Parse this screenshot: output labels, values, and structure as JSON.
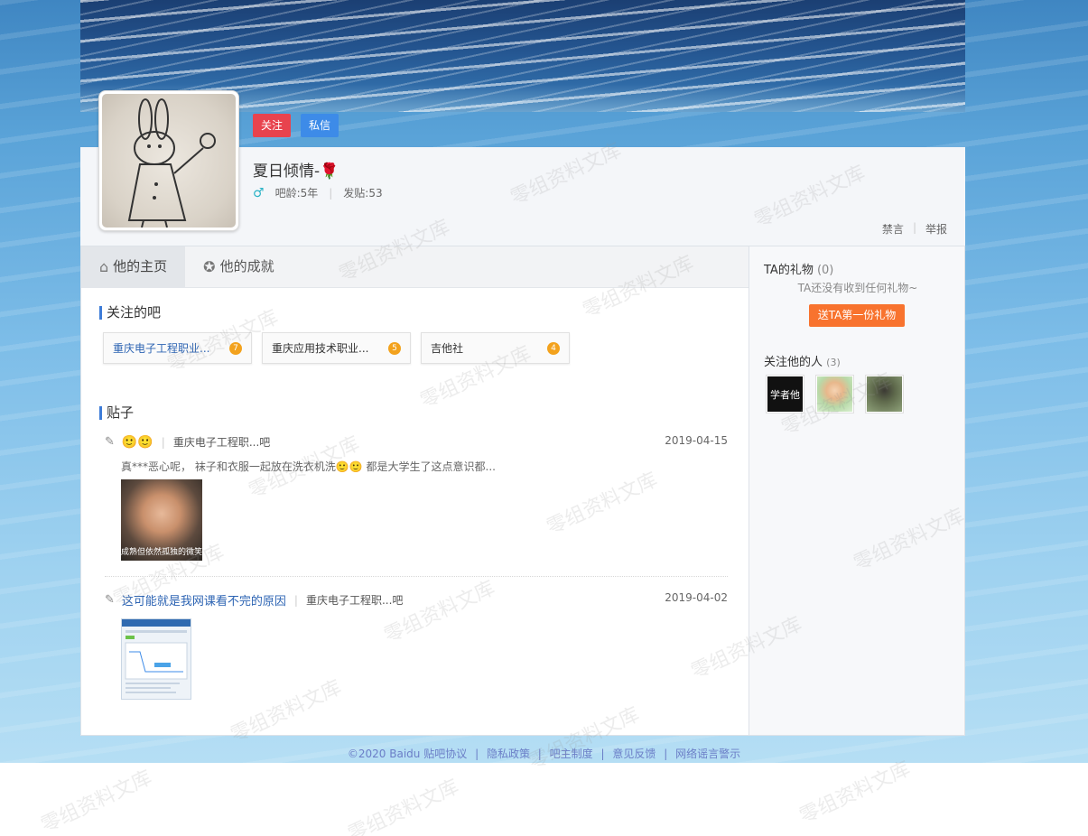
{
  "header": {
    "follow_label": "关注",
    "message_label": "私信",
    "username": "夏日倾情-🌹",
    "age_label": "吧龄:5年",
    "posts_label": "发贴:53",
    "mute_label": "禁言",
    "report_label": "举报"
  },
  "tabs": [
    {
      "label": "他的主页",
      "icon": "home-icon",
      "active": true
    },
    {
      "label": "他的成就",
      "icon": "badge-icon",
      "active": false
    }
  ],
  "followed_forums": {
    "title": "关注的吧",
    "items": [
      {
        "name": "重庆电子工程职业...",
        "level": "7"
      },
      {
        "name": "重庆应用技术职业...",
        "level": "5"
      },
      {
        "name": "吉他社",
        "level": "4"
      }
    ]
  },
  "posts": {
    "title": "贴子",
    "items": [
      {
        "title_emoji": "🙂🙂",
        "forum": "重庆电子工程职...吧",
        "date": "2019-04-15",
        "excerpt": "真***恶心呢， 袜子和衣服一起放在洗衣机洗🙂🙂 都是大学生了这点意识都...",
        "image_caption": "成熟但依然孤独的微笑"
      },
      {
        "title": "这可能就是我网课看不完的原因",
        "forum": "重庆电子工程职...吧",
        "date": "2019-04-02"
      }
    ]
  },
  "sidebar": {
    "gifts_title": "TA的礼物",
    "gifts_count": "(0)",
    "gifts_empty": "TA还没有收到任何礼物~",
    "gift_button": "送TA第一份礼物",
    "followers_title": "关注他的人",
    "followers_count": "(3)",
    "follower1_text": "学者他"
  },
  "footer": {
    "copyright": "©2020 Baidu",
    "links": [
      "贴吧协议",
      "隐私政策",
      "吧主制度",
      "意见反馈",
      "网络谣言警示"
    ]
  },
  "watermark_text": "零组资料文库",
  "colors": {
    "follow_button": "#e8434e",
    "message_button": "#3d8be8",
    "gift_button": "#f8732e",
    "link_blue": "#2d64b3",
    "section_accent": "#3d7cd8"
  }
}
